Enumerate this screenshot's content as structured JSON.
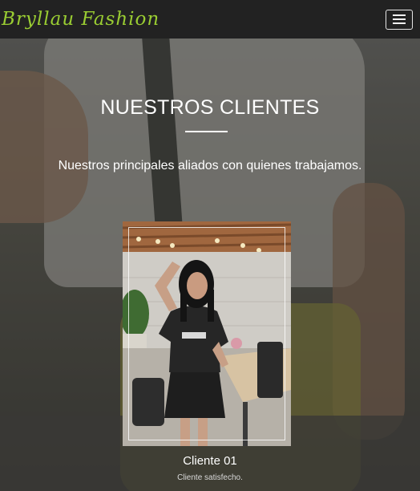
{
  "navbar": {
    "brand": "Bryllau Fashion",
    "brand_color": "#9acd32",
    "menu_icon": "hamburger-icon"
  },
  "section": {
    "title": "NUESTROS CLIENTES",
    "subtitle": "Nuestros principales aliados con quienes trabajamos."
  },
  "clients": [
    {
      "name": "Cliente 01",
      "description": "Cliente satisfecho."
    }
  ]
}
